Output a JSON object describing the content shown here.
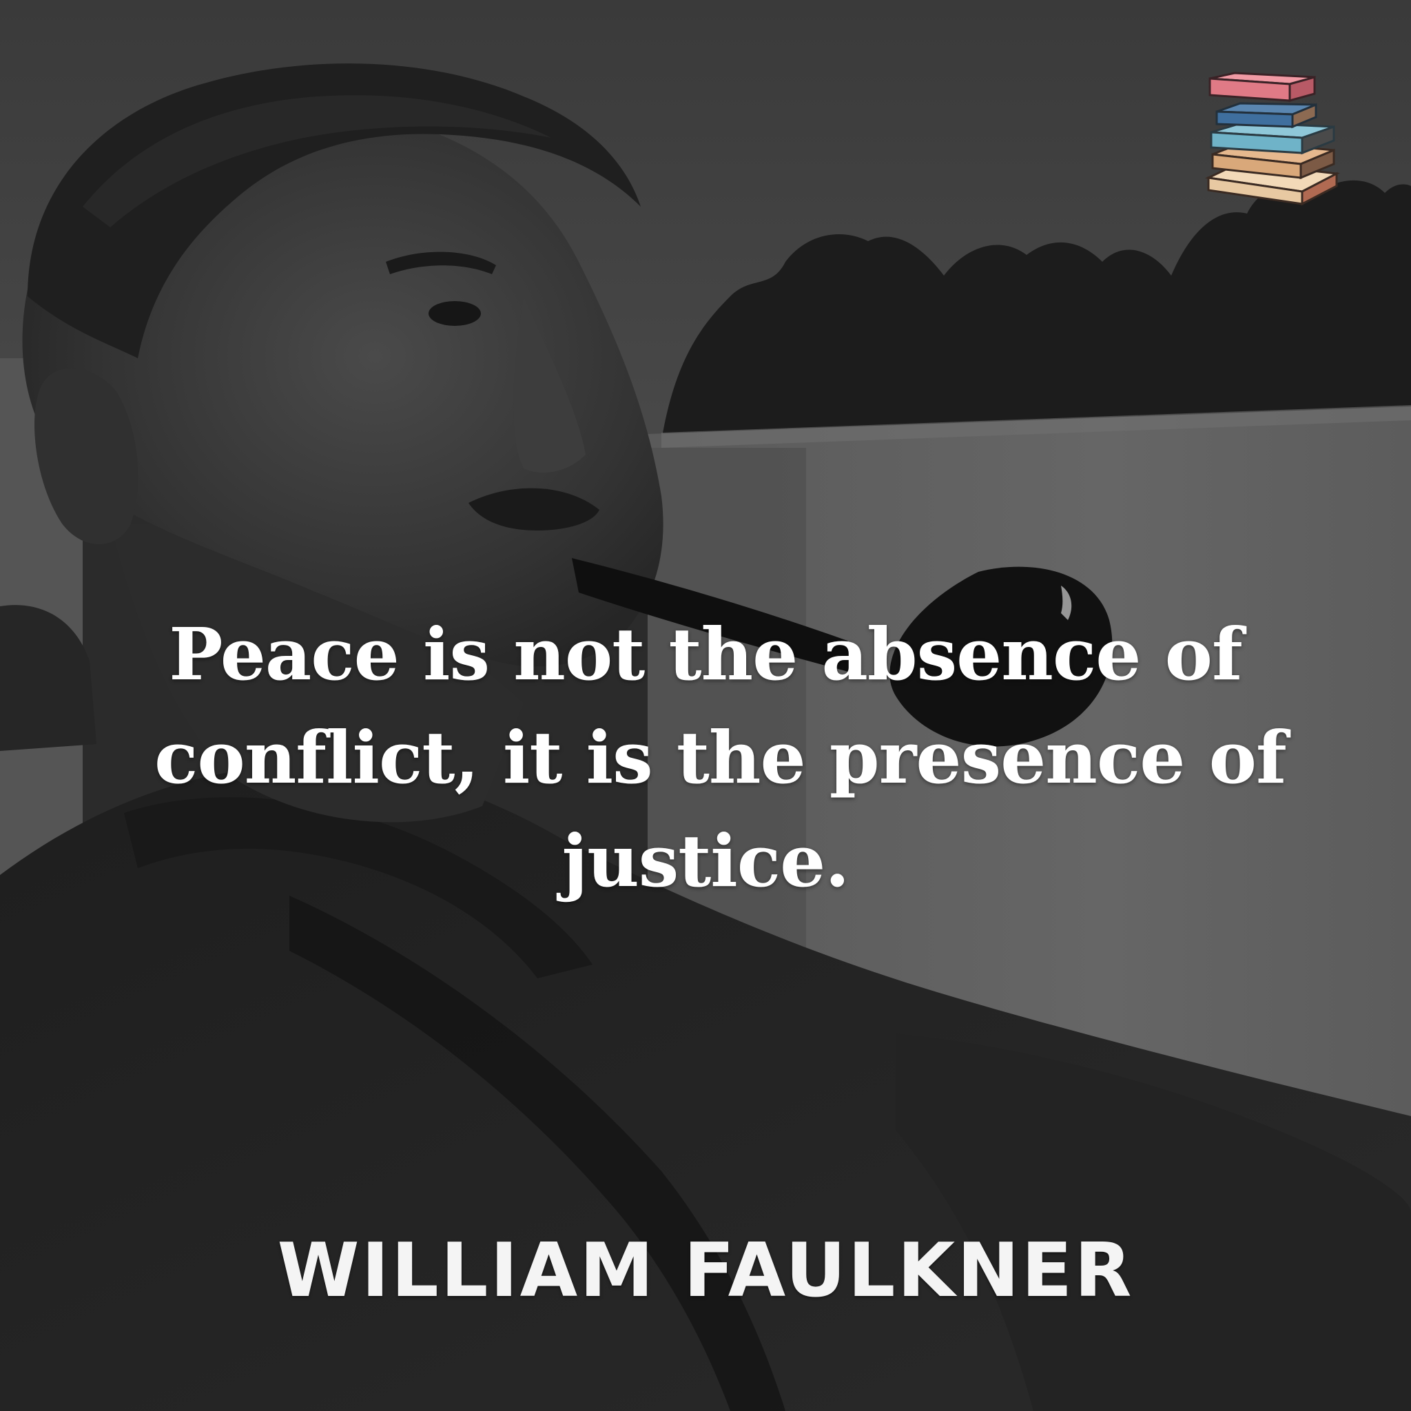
{
  "quote": {
    "lines": [
      "Peace is not the absence of",
      "conflict, it is the presence of",
      "justice."
    ]
  },
  "author": {
    "name": "WILLIAM FAULKNER"
  },
  "logo": {
    "icon": "book-stack-icon",
    "colors": [
      "#e07a86",
      "#3f6f9e",
      "#6fb3c8",
      "#e6b88e",
      "#f2d9b8"
    ]
  },
  "photo": {
    "icon": "portrait-photo",
    "palette": "grayscale"
  }
}
